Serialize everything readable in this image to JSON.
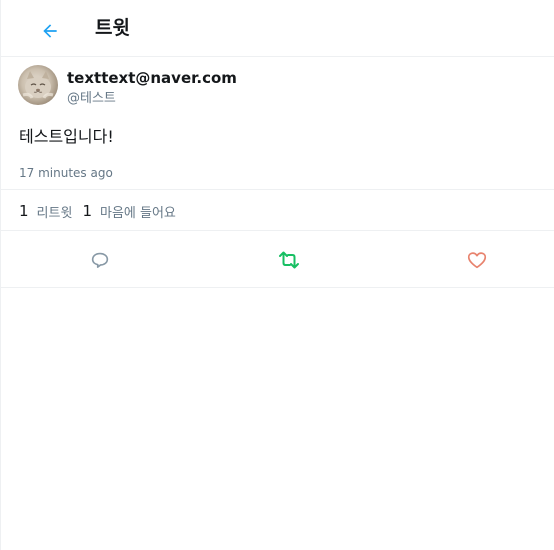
{
  "header": {
    "title": "트윗",
    "back_icon": "arrow-left-icon"
  },
  "tweet": {
    "author_name": "texttext@naver.com",
    "author_handle": "@테스트",
    "text": "테스트입니다!",
    "time": "17 minutes ago"
  },
  "stats": {
    "retweet_count": "1",
    "retweet_label": "리트윗",
    "like_count": "1",
    "like_label": "마음에 들어요"
  },
  "actions": {
    "reply_icon": "comment-icon",
    "retweet_icon": "retweet-icon",
    "like_icon": "heart-icon"
  },
  "colors": {
    "accent": "#1da1f2",
    "retweet": "#17bf63",
    "like": "#e0245e",
    "muted": "#657786",
    "border": "#eef0f2"
  }
}
